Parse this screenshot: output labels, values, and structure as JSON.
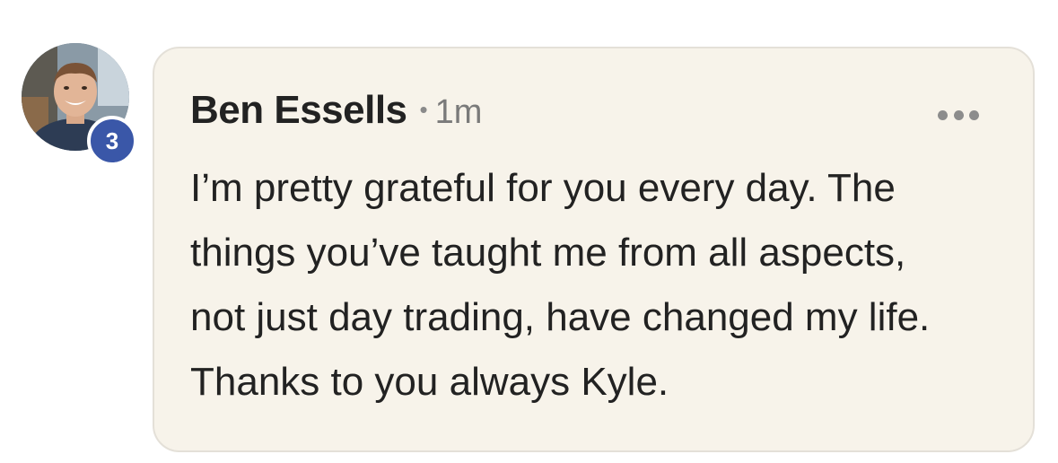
{
  "comment": {
    "author": "Ben Essells",
    "separator": "•",
    "timestamp": "1m",
    "badge_count": "3",
    "more_icon": "more-horizontal-icon",
    "body_lines": [
      "I’m pretty grateful for you every day. The",
      "things you’ve taught me from all aspects,",
      "not just day trading, have changed my life.",
      "Thanks to you always Kyle."
    ]
  },
  "colors": {
    "bubble_background": "#f7f3ea",
    "badge_background": "#3a57a8",
    "text": "#222222",
    "muted_text": "#7a7a7a"
  }
}
